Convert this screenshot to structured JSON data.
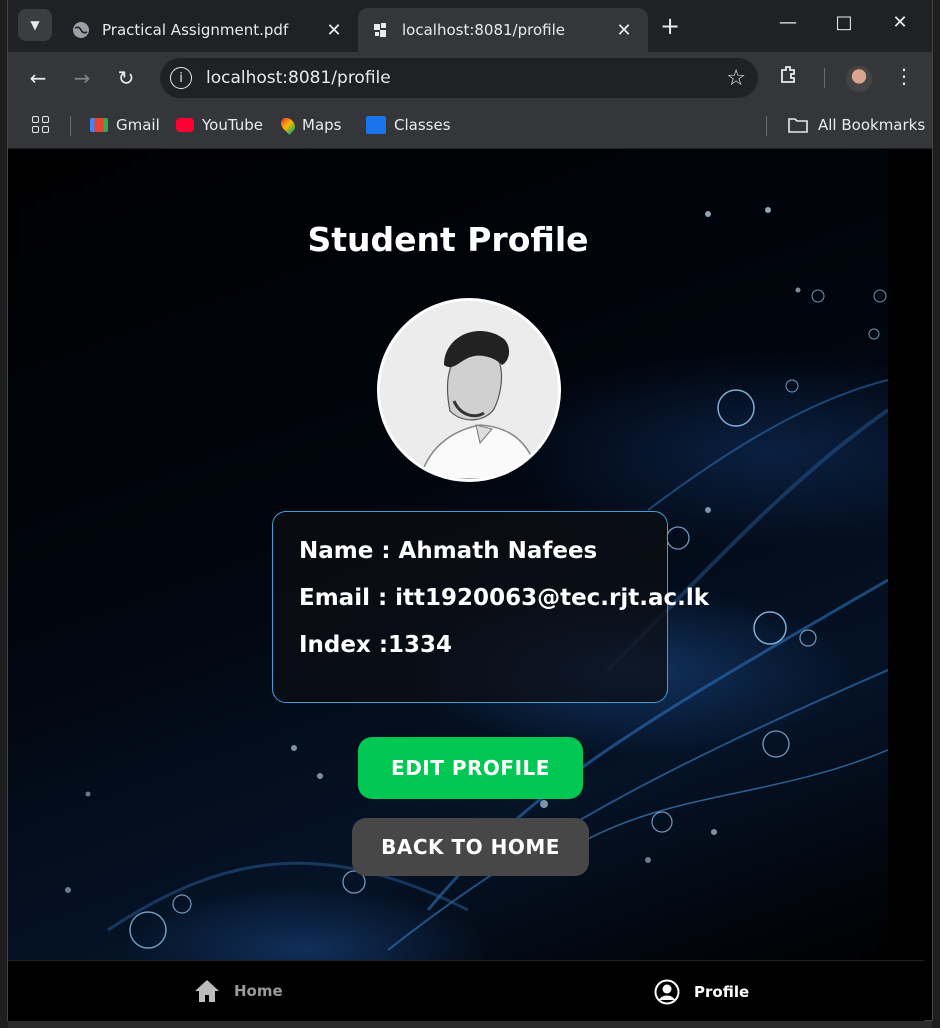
{
  "browser": {
    "tabs": [
      {
        "title": "Practical Assignment.pdf",
        "active": false
      },
      {
        "title": "localhost:8081/profile",
        "active": true
      }
    ],
    "address": "localhost:8081/profile",
    "bookmarks": [
      "Gmail",
      "YouTube",
      "Maps",
      "Classes"
    ],
    "all_bookmarks": "All Bookmarks"
  },
  "page": {
    "title": "Student Profile",
    "info": {
      "name_line": "Name : Ahmath Nafees",
      "email_line": "Email : itt1920063@tec.rjt.ac.lk",
      "index_line": "Index :1334"
    },
    "edit_button": "EDIT PROFILE",
    "back_button": "BACK TO HOME"
  },
  "bottom_nav": {
    "home": "Home",
    "profile": "Profile"
  },
  "colors": {
    "edit_button": "#00c853",
    "back_button": "#474747",
    "card_border": "#3ba0d6"
  },
  "icons": [
    "tab-search-icon",
    "globe-icon",
    "close-icon",
    "plus-icon",
    "minimize-icon",
    "maximize-icon",
    "back-icon",
    "forward-icon",
    "reload-icon",
    "info-icon",
    "star-icon",
    "extensions-icon",
    "kebab-icon",
    "apps-icon",
    "folder-icon",
    "home-icon",
    "user-circle-icon"
  ]
}
